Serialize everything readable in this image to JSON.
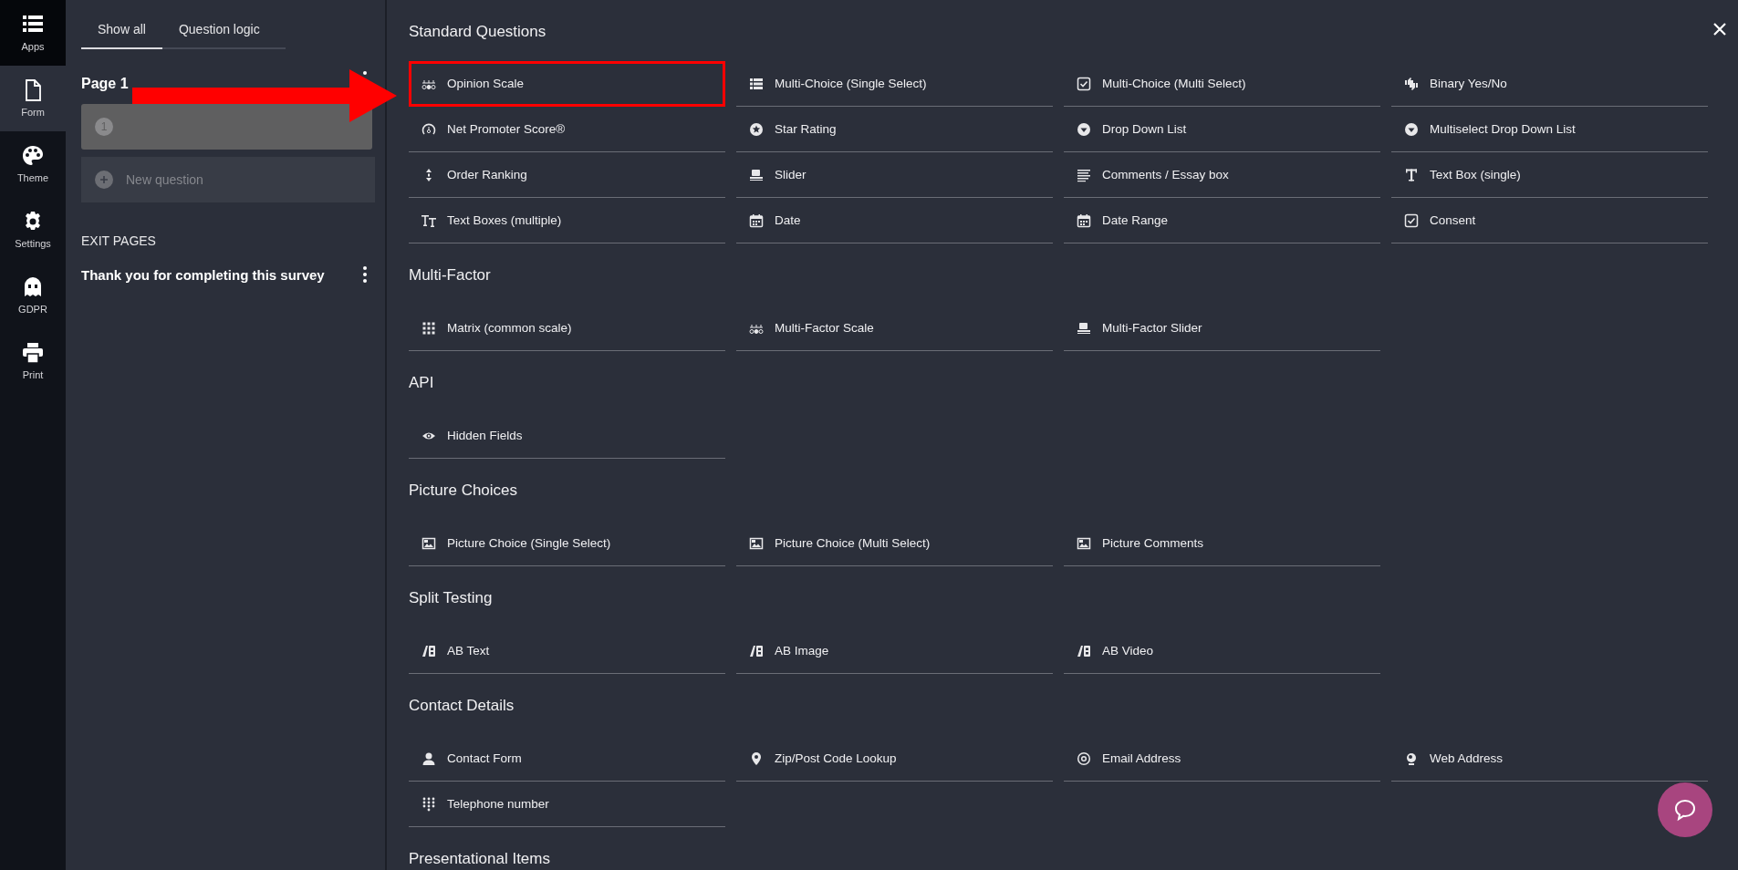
{
  "rail": [
    {
      "label": "Apps",
      "selected": false
    },
    {
      "label": "Form",
      "selected": true
    },
    {
      "label": "Theme",
      "selected": false
    },
    {
      "label": "Settings",
      "selected": false
    },
    {
      "label": "GDPR",
      "selected": false
    },
    {
      "label": "Print",
      "selected": false
    }
  ],
  "tabs": [
    {
      "label": "Show all",
      "selected": true
    },
    {
      "label": "Question logic",
      "selected": false
    }
  ],
  "page": {
    "title": "Page 1",
    "questions": [
      {
        "number": "1"
      }
    ],
    "new_question": "New question"
  },
  "exit_pages": {
    "heading": "EXIT PAGES",
    "items": [
      "Thank you for completing this survey"
    ]
  },
  "sections": [
    {
      "title": "Standard Questions",
      "items": [
        {
          "label": "Opinion Scale",
          "highlighted": true
        },
        {
          "label": "Multi-Choice (Single Select)",
          "highlighted": false
        },
        {
          "label": "Multi-Choice (Multi Select)",
          "highlighted": false
        },
        {
          "label": "Binary Yes/No",
          "highlighted": false
        },
        {
          "label": "Net Promoter Score®",
          "highlighted": false
        },
        {
          "label": "Star Rating",
          "highlighted": false
        },
        {
          "label": "Drop Down List",
          "highlighted": false
        },
        {
          "label": "Multiselect Drop Down List",
          "highlighted": false
        },
        {
          "label": "Order Ranking",
          "highlighted": false
        },
        {
          "label": "Slider",
          "highlighted": false
        },
        {
          "label": "Comments / Essay box",
          "highlighted": false
        },
        {
          "label": "Text Box (single)",
          "highlighted": false
        },
        {
          "label": "Text Boxes (multiple)",
          "highlighted": false
        },
        {
          "label": "Date",
          "highlighted": false
        },
        {
          "label": "Date Range",
          "highlighted": false
        },
        {
          "label": "Consent",
          "highlighted": false
        }
      ]
    },
    {
      "title": "Multi-Factor",
      "items": [
        {
          "label": "Matrix (common scale)",
          "highlighted": false
        },
        {
          "label": "Multi-Factor Scale",
          "highlighted": false
        },
        {
          "label": "Multi-Factor Slider",
          "highlighted": false
        }
      ]
    },
    {
      "title": "API",
      "items": [
        {
          "label": "Hidden Fields",
          "highlighted": false
        }
      ]
    },
    {
      "title": "Picture Choices",
      "items": [
        {
          "label": "Picture Choice (Single Select)",
          "highlighted": false
        },
        {
          "label": "Picture Choice (Multi Select)",
          "highlighted": false
        },
        {
          "label": "Picture Comments",
          "highlighted": false
        }
      ]
    },
    {
      "title": "Split Testing",
      "items": [
        {
          "label": "AB Text",
          "highlighted": false
        },
        {
          "label": "AB Image",
          "highlighted": false
        },
        {
          "label": "AB Video",
          "highlighted": false
        }
      ]
    },
    {
      "title": "Contact Details",
      "items": [
        {
          "label": "Contact Form",
          "highlighted": false
        },
        {
          "label": "Zip/Post Code Lookup",
          "highlighted": false
        },
        {
          "label": "Email Address",
          "highlighted": false
        },
        {
          "label": "Web Address",
          "highlighted": false
        },
        {
          "label": "Telephone number",
          "highlighted": false
        }
      ]
    },
    {
      "title": "Presentational Items"
    }
  ]
}
